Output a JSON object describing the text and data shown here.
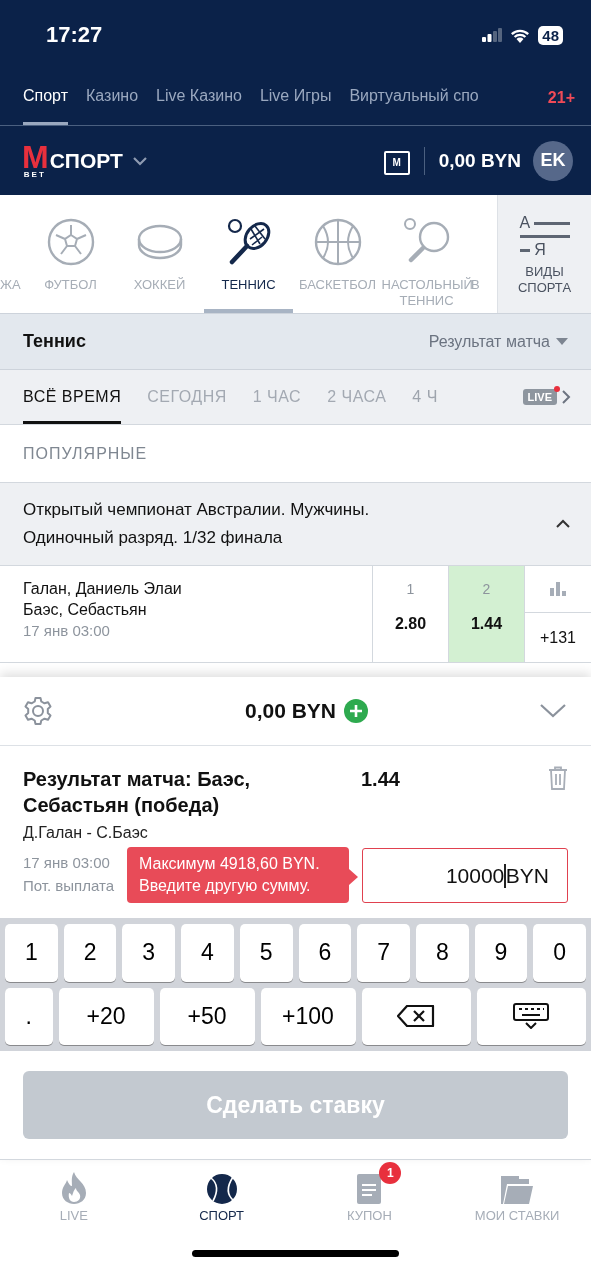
{
  "status_bar": {
    "time": "17:27",
    "battery": "48"
  },
  "top_tabs": [
    {
      "label": "Спорт",
      "selected": true
    },
    {
      "label": "Казино",
      "selected": false
    },
    {
      "label": "Live Казино",
      "selected": false
    },
    {
      "label": "Live Игры",
      "selected": false
    },
    {
      "label": "Виртуальный спо",
      "selected": false
    }
  ],
  "age_badge": "21+",
  "header": {
    "logo_letter": "M",
    "logo_sub": "BET",
    "section": "СПОРТ",
    "gift_letter": "M",
    "balance": "0,00 BYN",
    "avatar": "EK"
  },
  "sports": [
    {
      "label": "ЖА",
      "kind": "cut",
      "selected": false
    },
    {
      "label": "ФУТБОЛ",
      "kind": "football",
      "selected": false
    },
    {
      "label": "ХОККЕЙ",
      "kind": "hockey",
      "selected": false
    },
    {
      "label": "ТЕННИС",
      "kind": "tennis",
      "selected": true
    },
    {
      "label": "БАСКЕТБОЛ",
      "kind": "basketball",
      "selected": false
    },
    {
      "label": "НАСТОЛЬНЫЙ ТЕННИС",
      "kind": "table-tennis",
      "selected": false
    },
    {
      "label": "В",
      "kind": "cut",
      "selected": false
    }
  ],
  "sports_menu": {
    "letter_top": "А",
    "letter_bottom": "Я",
    "label": "ВИДЫ СПОРТА"
  },
  "sport_title": "Теннис",
  "market": "Результат матча",
  "time_filters": [
    {
      "label": "ВСЁ ВРЕМЯ",
      "selected": true
    },
    {
      "label": "СЕГОДНЯ",
      "selected": false
    },
    {
      "label": "1 ЧАС",
      "selected": false
    },
    {
      "label": "2 ЧАСА",
      "selected": false
    },
    {
      "label": "4 Ч",
      "selected": false
    }
  ],
  "live_badge": "LIVE",
  "section_label": "ПОПУЛЯРНЫЕ",
  "tournament": {
    "title": "Открытый чемпионат Австралии. Мужчины. Одиночный разряд. 1/32 финала",
    "expanded": true
  },
  "match": {
    "player_1": "Галан, Даниель Элаи",
    "player_2": "Баэс, Себастьян",
    "time": "17 янв 03:00",
    "odds": [
      {
        "label": "1",
        "value": "2.80",
        "selected": false
      },
      {
        "label": "2",
        "value": "1.44",
        "selected": true
      }
    ],
    "more": "+131"
  },
  "betslip": {
    "balance": "0,00 BYN",
    "expanded": true,
    "bet_title": "Результат матча: Баэс, Себастьян (победа)",
    "odds": "1.44",
    "event": "Д.Галан - С.Баэс",
    "time": "17 янв 03:00",
    "payout_label": "Пот. выплата",
    "amount": "10000",
    "currency": "BYN",
    "error": "Максимум 4918,60 BYN. Введите другую сумму."
  },
  "keyboard": [
    [
      {
        "kind": "key",
        "label": "1"
      },
      {
        "kind": "key",
        "label": "2"
      },
      {
        "kind": "key",
        "label": "3"
      },
      {
        "kind": "key",
        "label": "4"
      },
      {
        "kind": "key",
        "label": "5"
      },
      {
        "kind": "key",
        "label": "6"
      },
      {
        "kind": "key",
        "label": "7"
      },
      {
        "kind": "key",
        "label": "8"
      },
      {
        "kind": "key",
        "label": "9"
      },
      {
        "kind": "key",
        "label": "0"
      }
    ],
    [
      {
        "kind": "key",
        "label": "."
      },
      {
        "kind": "key",
        "label": "+20"
      },
      {
        "kind": "key",
        "label": "+50"
      },
      {
        "kind": "key",
        "label": "+100"
      },
      {
        "kind": "backspace"
      },
      {
        "kind": "hide"
      }
    ]
  ],
  "submit": {
    "label": "Сделать ставку",
    "disabled": true
  },
  "bottom_nav": [
    {
      "label": "LIVE",
      "kind": "live",
      "selected": false
    },
    {
      "label": "СПОРТ",
      "kind": "sport",
      "selected": true
    },
    {
      "label": "КУПОН",
      "kind": "coupon",
      "selected": false,
      "badge": "1"
    },
    {
      "label": "МОИ СТАВКИ",
      "kind": "bets",
      "selected": false
    }
  ]
}
